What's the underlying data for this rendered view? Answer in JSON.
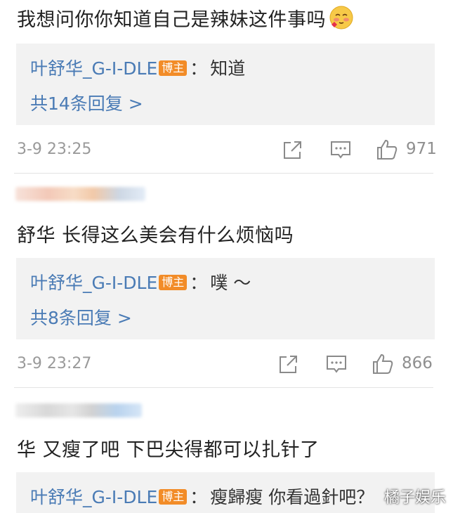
{
  "comments": [
    {
      "text": "我想问你你知道自己是辣妹这件事吗",
      "reply_author": "叶舒华_G-I-DLE",
      "reply_badge": "博主",
      "reply_sep": "：",
      "reply_text": "知道",
      "more_replies": "共14条回复 >",
      "time": "3-9 23:25",
      "likes": "971"
    },
    {
      "text": "舒华  长得这么美会有什么烦恼吗",
      "reply_author": "叶舒华_G-I-DLE",
      "reply_badge": "博主",
      "reply_sep": "：",
      "reply_text": "噗 ～",
      "more_replies": "共8条回复 >",
      "time": "3-9 23:27",
      "likes": "866"
    },
    {
      "text": "华  又瘦了吧  下巴尖得都可以扎针了",
      "reply_author": "叶舒华_G-I-DLE",
      "reply_badge": "博主",
      "reply_sep": "：",
      "reply_text": "瘦歸瘦  你看過針吧？"
    }
  ],
  "icons": {
    "share": "share-icon",
    "comment": "comment-icon",
    "like": "thumbs-up-icon",
    "emoji": "blushing-face-emoji"
  },
  "colors": {
    "author": "#4a7bb5",
    "badge": "#f28c28",
    "reply_bg": "#f2f2f2",
    "meta": "#9a9a9a"
  },
  "watermark": "橘子娱乐"
}
